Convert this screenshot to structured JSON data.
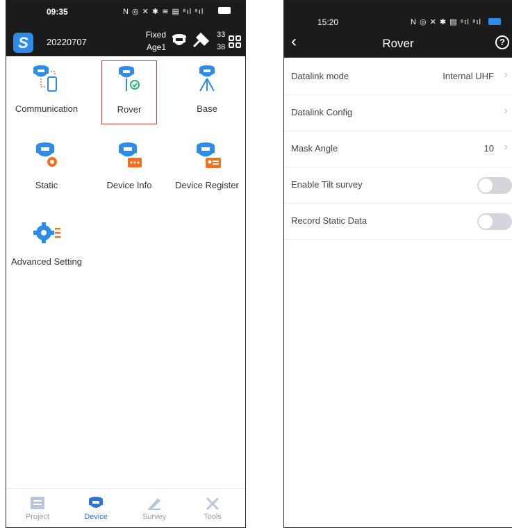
{
  "left": {
    "status_time": "09:35",
    "status_icons": "N ◎ ✕ ✱ ≋ ▤ ⁸ıl ⁸ıl",
    "app_logo": "S",
    "project_code": "20220707",
    "fix_status": "Fixed",
    "age": "Age1",
    "satellites_top": "33",
    "satellites_bottom": "38",
    "tiles": [
      {
        "label": "Communication"
      },
      {
        "label": "Rover"
      },
      {
        "label": "Base"
      },
      {
        "label": "Static"
      },
      {
        "label": "Device Info"
      },
      {
        "label": "Device Register"
      },
      {
        "label": "Advanced Setting"
      }
    ],
    "nav": [
      {
        "label": "Project"
      },
      {
        "label": "Device"
      },
      {
        "label": "Survey"
      },
      {
        "label": "Tools"
      }
    ]
  },
  "right": {
    "status_time": "15:20",
    "status_icons": "N ◎ ✕ ✱ ▤ ⁸ıl ⁸ıl",
    "title": "Rover",
    "back_icon": "‹",
    "help_icon": "?",
    "rows": [
      {
        "label": "Datalink mode",
        "value": "Internal UHF"
      },
      {
        "label": "Datalink Config",
        "value": ""
      },
      {
        "label": "Mask Angle",
        "value": "10"
      },
      {
        "label": "Enable Tilt survey",
        "toggle": false
      },
      {
        "label": "Record Static Data",
        "toggle": false
      }
    ]
  },
  "colors": {
    "accent": "#2f8be8",
    "highlight": "#d33333",
    "header": "#1b1b1b",
    "icon_orange": "#f07020"
  }
}
